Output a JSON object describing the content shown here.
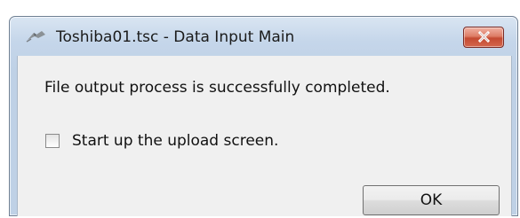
{
  "window": {
    "title": "Toshiba01.tsc - Data Input Main",
    "app_icon": "toshiba-app-icon",
    "close_icon": "close-icon"
  },
  "dialog": {
    "message": "File output process is successfully completed.",
    "checkbox": {
      "label": "Start up the upload screen.",
      "checked": false
    },
    "ok_button": "OK"
  },
  "colors": {
    "close_button_red": "#c44a32",
    "frame_blue": "#c5d6ea",
    "client_background": "#f0f0f0"
  }
}
